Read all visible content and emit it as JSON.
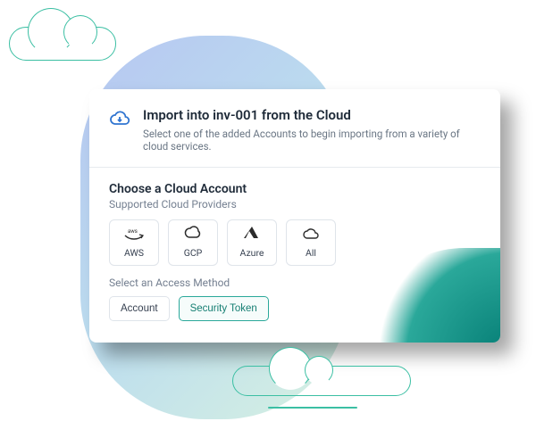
{
  "header": {
    "title": "Import into inv-001 from the Cloud",
    "subtitle": "Select one of the added Accounts to begin importing from a variety of cloud services."
  },
  "section": {
    "title": "Choose a Cloud Account",
    "providers_label": "Supported Cloud Providers"
  },
  "providers": [
    {
      "id": "aws",
      "label": "AWS"
    },
    {
      "id": "gcp",
      "label": "GCP"
    },
    {
      "id": "azure",
      "label": "Azure"
    },
    {
      "id": "all",
      "label": "All"
    }
  ],
  "access": {
    "label": "Select an Access Method",
    "options": [
      {
        "id": "account",
        "label": "Account",
        "selected": false
      },
      {
        "id": "token",
        "label": "Security Token",
        "selected": true
      }
    ]
  },
  "icons": {
    "header": "cloud-download-icon",
    "aws": "aws-icon",
    "gcp": "gcp-icon",
    "azure": "azure-icon",
    "all": "cloud-icon"
  },
  "colors": {
    "accent": "#2aa89a",
    "text": "#1e2a38",
    "muted": "#758091"
  }
}
